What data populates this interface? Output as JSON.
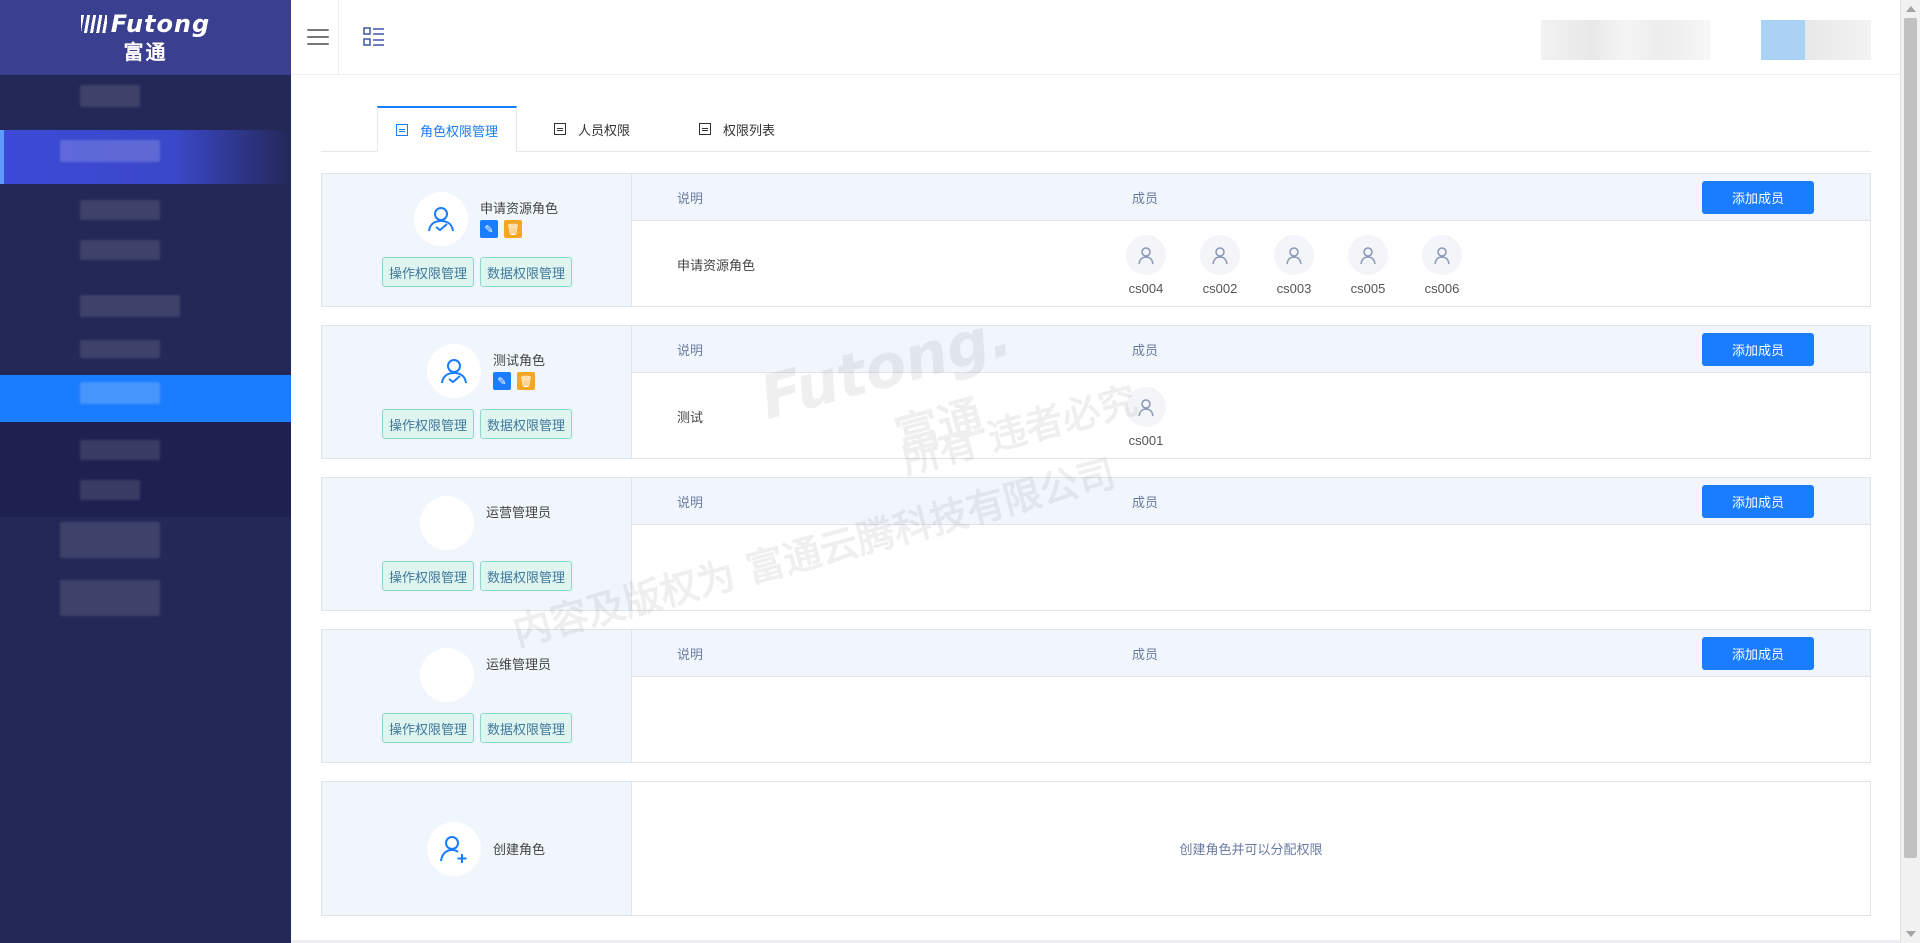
{
  "brand": {
    "logo_text": "Futong",
    "logo_sub": "富通"
  },
  "tabs": [
    {
      "label": "角色权限管理",
      "active": true
    },
    {
      "label": "人员权限",
      "active": false
    },
    {
      "label": "权限列表",
      "active": false
    }
  ],
  "columns": {
    "description": "说明",
    "members": "成员",
    "add_member": "添加成员"
  },
  "buttons": {
    "operation_perm": "操作权限管理",
    "data_perm": "数据权限管理"
  },
  "roles": [
    {
      "name": "申请资源角色",
      "description": "申请资源角色",
      "members": [
        "cs004",
        "cs002",
        "cs003",
        "cs005",
        "cs006"
      ]
    },
    {
      "name": "测试角色",
      "description": "测试",
      "members": [
        "cs001"
      ]
    },
    {
      "name": "运营管理员",
      "description": "",
      "members": []
    },
    {
      "name": "运维管理员",
      "description": "",
      "members": []
    }
  ],
  "create_role": {
    "label": "创建角色",
    "hint": "创建角色并可以分配权限"
  },
  "watermark": {
    "logo": "Futong.",
    "sub": "富通",
    "line1": "所有  违者必究",
    "line2": "内容及版权为  富通云腾科技有限公司"
  },
  "icons": {
    "menu": "hamburger-icon",
    "list": "list-icon",
    "user": "user-icon",
    "add_user": "add-user-icon",
    "edit": "wrench-icon",
    "delete": "trash-icon"
  },
  "colors": {
    "primary": "#1a7cfe",
    "sidebar": "#242857",
    "logo_bg": "#3b3f8f",
    "warning": "#f5a623",
    "teal_btn": "#dff5f0"
  }
}
